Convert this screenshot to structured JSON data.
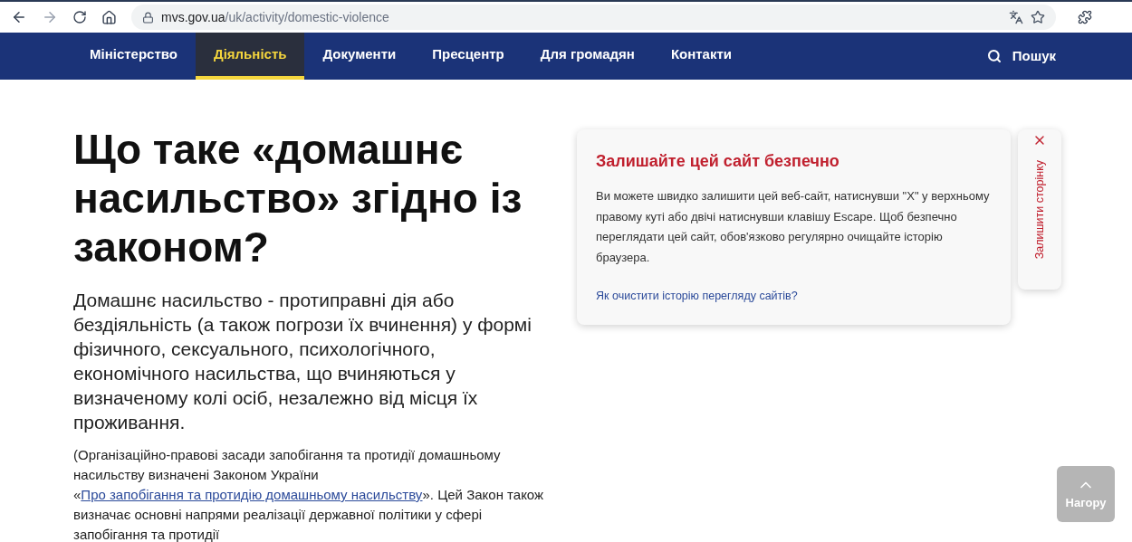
{
  "browser": {
    "url_host": "mvs.gov.ua",
    "url_path": "/uk/activity/domestic-violence"
  },
  "nav": {
    "items": [
      {
        "label": "Міністерство",
        "selected": false
      },
      {
        "label": "Діяльність",
        "selected": true
      },
      {
        "label": "Документи",
        "selected": false
      },
      {
        "label": "Пресцентр",
        "selected": false
      },
      {
        "label": "Для громадян",
        "selected": false
      },
      {
        "label": "Контакти",
        "selected": false
      }
    ],
    "search": "Пошук"
  },
  "heading": "Що таке «домашнє насильство» згідно із законом?",
  "lead": "Домашнє насильство - протиправні дія або бездіяльність (а також погрози їх вчинення) у формі фізичного, сексуального, психологічного, економічного насильства, що вчиняються у визначеному колі осіб, незалежно від місця їх проживання.",
  "note": {
    "before": "(Організаційно-правові засади запобігання та протидії домашньому насильству визначені Законом України «",
    "link": "Про запобігання та протидію домашньому насильству",
    "after": "». Цей Закон також визначає основні напрями реалізації державної політики у сфері запобігання та протидії"
  },
  "safety_card": {
    "title": "Залишайте цей сайт безпечно",
    "text": "Ви можете швидко залишити цей веб-сайт, натиснувши \"X\" у верхньому правому куті або двічі натиснувши клавішу Escape. Щоб безпечно переглядати цей сайт, обов'язково регулярно очищайте історію браузера.",
    "link": "Як очистити історію перегляду сайтів?"
  },
  "leave_tab": {
    "label": "Залишити сторінку"
  },
  "back_to_top": "Нагору"
}
